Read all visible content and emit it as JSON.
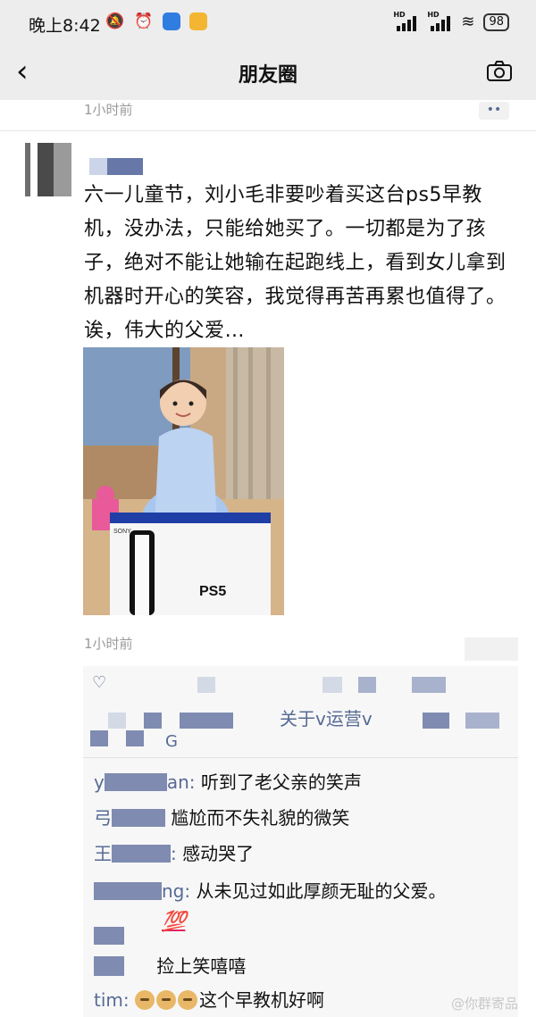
{
  "status_bar": {
    "time": "晚上8:42",
    "battery": "98",
    "network_label": "HD"
  },
  "nav": {
    "title": "朋友圈"
  },
  "previous_post": {
    "time": "1小时前"
  },
  "post": {
    "text": "六一儿童节，刘小毛非要吵着买这台ps5早教机，没办法，只能给她买了。一切都是为了孩子，绝对不能让她输在起跑线上，看到女儿拿到机器时开心的笑容，我觉得再苦再累也值得了。诶，伟大的父爱…",
    "photo_brand": "SONY",
    "photo_product": "PS5",
    "time": "1小时前"
  },
  "likes": {
    "partial_text": "关于v运营v",
    "tail": "G"
  },
  "comments": [
    {
      "name_suffix": "an:",
      "text": "听到了老父亲的笑声"
    },
    {
      "name_suffix": "",
      "text": "尴尬而不失礼貌的微笑"
    },
    {
      "name_suffix": ":",
      "text": "感动哭了"
    },
    {
      "name_suffix": "ng:",
      "text": "从未见过如此厚颜无耻的父爱。"
    },
    {
      "name_suffix": "",
      "text": "💯"
    },
    {
      "name_suffix": "",
      "text": "捡上笑嘻嘻"
    },
    {
      "name_suffix": "tim:",
      "text": "这个早教机好啊"
    }
  ],
  "watermark": "@你群寄品",
  "colors": {
    "link_blue": "#576b95",
    "nav_bg": "#ededed",
    "comment_bg": "#f7f7f7"
  }
}
